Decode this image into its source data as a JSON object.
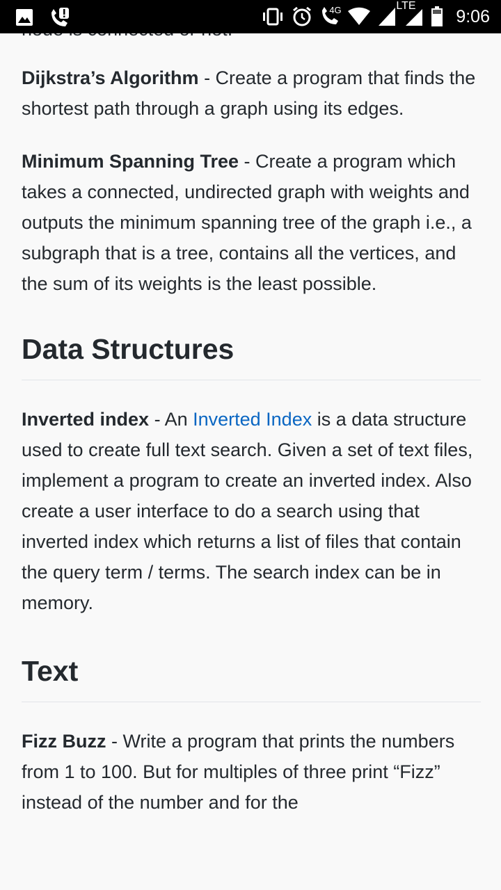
{
  "status_bar": {
    "network_label": "4G",
    "lte_label": "LTE",
    "time": "9:06"
  },
  "article": {
    "top_fragment": "node is connected or not.",
    "dijkstra": {
      "term": "Dijkstra’s Algorithm",
      "desc": " - Create a program that finds the shortest path through a graph using its edges."
    },
    "mst": {
      "term": "Minimum Spanning Tree",
      "desc": " - Create a program which takes a connected, undirected graph with weights and outputs the minimum spanning tree of the graph i.e., a subgraph that is a tree, contains all the vertices, and the sum of its weights is the least possible."
    },
    "data_structures_heading": "Data Structures",
    "inverted": {
      "term": "Inverted index",
      "pre": " - An ",
      "link": "Inverted Index",
      "desc": " is a data structure used to create full text search. Given a set of text files, implement a program to create an inverted index. Also create a user interface to do a search using that inverted index which returns a list of files that contain the query term / terms. The search index can be in memory."
    },
    "text_heading": "Text",
    "fizzbuzz": {
      "term": "Fizz Buzz",
      "desc": " - Write a program that prints the numbers from 1 to 100. But for multiples of three print “Fizz” instead of the number and for the"
    }
  },
  "colors": {
    "link": "#0a66c2",
    "text": "#24292e",
    "background": "#f9f9f9",
    "status_bar": "#000000"
  }
}
